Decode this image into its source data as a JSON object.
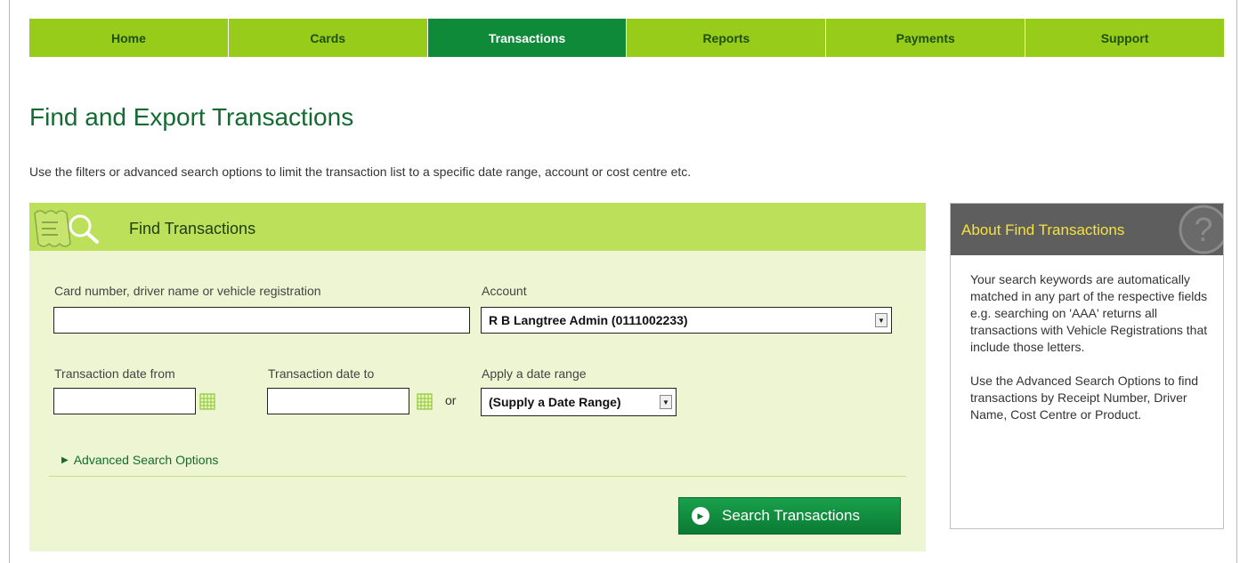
{
  "nav": {
    "items": [
      {
        "label": "Home",
        "active": false
      },
      {
        "label": "Cards",
        "active": false
      },
      {
        "label": "Transactions",
        "active": true
      },
      {
        "label": "Reports",
        "active": false
      },
      {
        "label": "Payments",
        "active": false
      },
      {
        "label": "Support",
        "active": false
      }
    ]
  },
  "page": {
    "title": "Find and Export Transactions",
    "intro": "Use the filters or advanced search options to limit the transaction list to a specific date range, account or cost centre etc."
  },
  "find": {
    "header_title": "Find Transactions",
    "icon": "receipt-search-icon",
    "keyword_label": "Card number, driver name or vehicle registration",
    "keyword_value": "",
    "account_label": "Account",
    "account_selected": "R B Langtree Admin (0111002233)",
    "date_from_label": "Transaction date from",
    "date_from_value": "",
    "date_to_label": "Transaction date to",
    "date_to_value": "",
    "or_text": "or",
    "date_range_label": "Apply a date range",
    "date_range_selected": "(Supply a Date Range)",
    "advanced_label": "Advanced Search Options",
    "search_button": "Search Transactions"
  },
  "about": {
    "title": "About Find Transactions",
    "paragraph1": "Your search keywords are automatically matched in any part of the respective fields e.g. searching on 'AAA' returns all transactions with Vehicle Registrations that include those letters.",
    "paragraph2": "Use the Advanced Search Options to find transactions by Receipt Number, Driver Name, Cost Centre or Product."
  },
  "colors": {
    "nav_bg": "#98cc1a",
    "nav_active": "#0f8a38",
    "title_green": "#136b32",
    "panel_bg": "#eef5d3",
    "panel_header": "#bde05a",
    "about_header": "#5e5e5e",
    "about_title": "#f5e33d"
  }
}
